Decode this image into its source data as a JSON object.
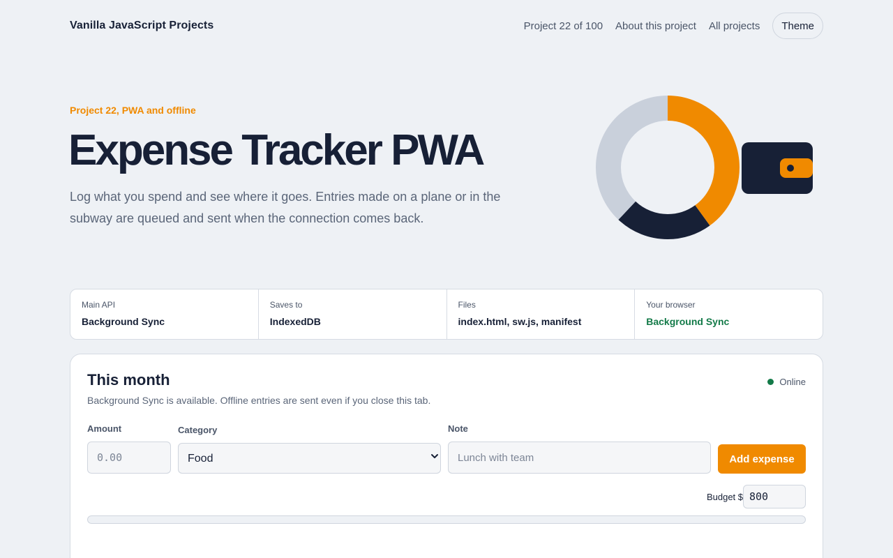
{
  "header": {
    "brand": "Vanilla JavaScript Projects",
    "project_counter": "Project 22 of 100",
    "about_link": "About this project",
    "all_link": "All projects",
    "theme_button": "Theme"
  },
  "hero": {
    "eyebrow": "Project 22, PWA and offline",
    "title": "Expense Tracker PWA",
    "description": "Log what you spend and see where it goes. Entries made on a plane or in the subway are queued and sent when the connection comes back."
  },
  "hero_art": {
    "donut_segments": [
      {
        "label": "orange",
        "fraction": 0.4,
        "color": "#f08a00"
      },
      {
        "label": "navy",
        "fraction": 0.22,
        "color": "#172036"
      },
      {
        "label": "grey",
        "fraction": 0.38,
        "color": "#c9d0db"
      }
    ],
    "wallet_color": "#172036",
    "clasp_color": "#f08a00"
  },
  "info": [
    {
      "label": "Main API",
      "value": "Background Sync",
      "status": "normal"
    },
    {
      "label": "Saves to",
      "value": "IndexedDB",
      "status": "normal"
    },
    {
      "label": "Files",
      "value": "index.html, sw.js, manifest",
      "status": "normal"
    },
    {
      "label": "Your browser",
      "value": "Background Sync",
      "status": "ok"
    }
  ],
  "card": {
    "title": "This month",
    "subtitle": "Background Sync is available. Offline entries are sent even if you close this tab.",
    "status": "Online",
    "amount_label": "Amount",
    "amount_placeholder": "0.00",
    "category_label": "Category",
    "category_selected": "Food",
    "note_label": "Note",
    "note_placeholder": "Lunch with team",
    "add_button": "Add expense",
    "budget_label": "Budget $",
    "budget_value": "800",
    "budget_used_fraction": 0
  },
  "colors": {
    "accent": "#f08a00",
    "navy": "#172036",
    "success": "#137a48",
    "background": "#eef1f5"
  }
}
